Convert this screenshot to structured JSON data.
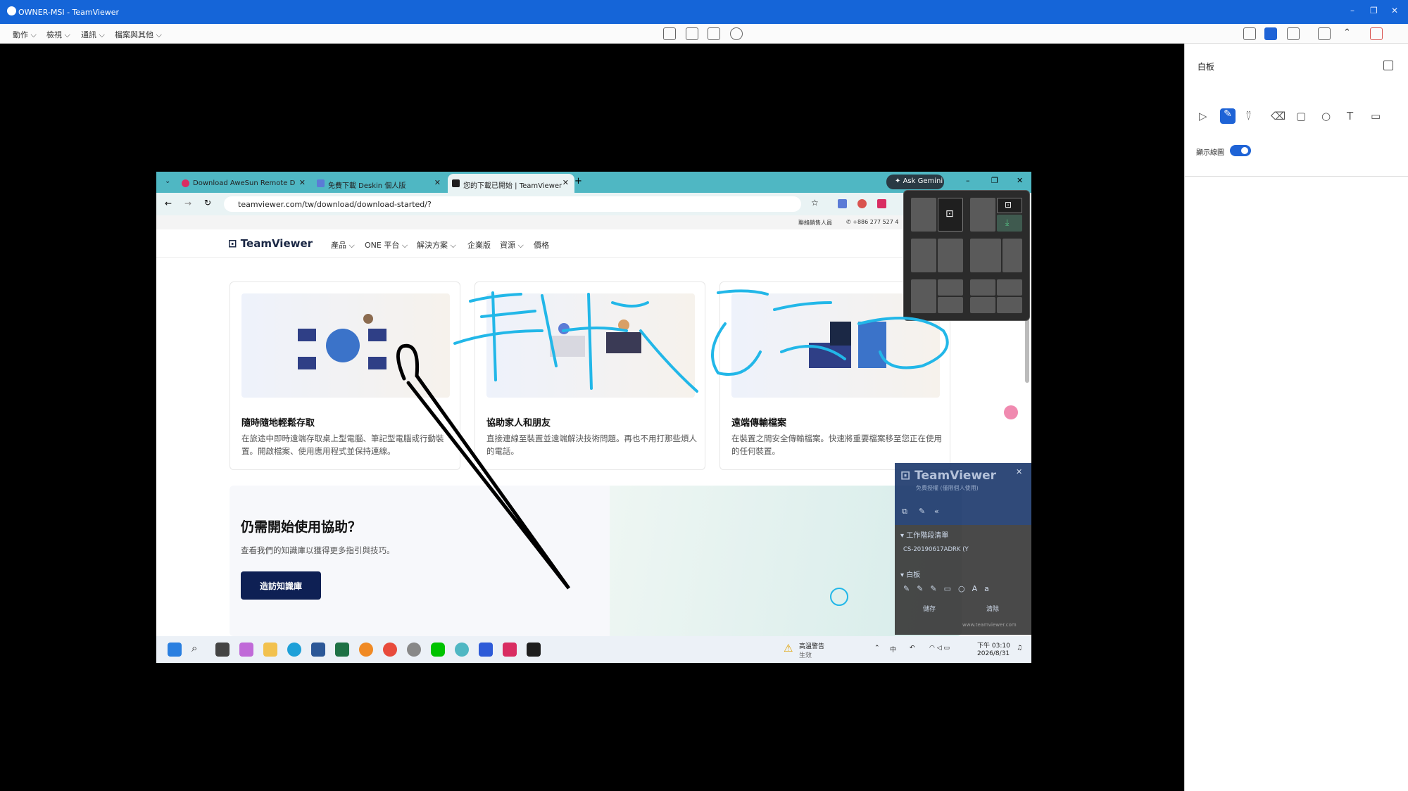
{
  "window": {
    "title": "OWNER-MSI - TeamViewer",
    "controls": [
      "–",
      "❐",
      "✕"
    ]
  },
  "toolbar": {
    "menus": [
      "動作",
      "檢視",
      "通訊",
      "檔案與其他"
    ]
  },
  "whiteboard": {
    "title": "白板",
    "show_strokes_label": "顯示線圖",
    "show_strokes_on": true,
    "tools": [
      "pointer-icon",
      "pen-icon",
      "highlighter-icon",
      "eraser-icon",
      "rectangle-icon",
      "circle-icon",
      "text-icon",
      "note-icon"
    ],
    "active_tool": "pen-icon",
    "accent": "#1e63d6"
  },
  "browser": {
    "tabs": [
      {
        "label": "Download AweSun Remote D",
        "fav": "#d92d62"
      },
      {
        "label": "免費下載 Deskin 個人版",
        "fav": "#5b7bd6"
      },
      {
        "label": "您的下載已開始 | TeamViewer",
        "fav": "#1e1e1e"
      }
    ],
    "ask_gemini": "Ask Gemini",
    "url": "teamviewer.com/tw/download/download-started/?",
    "infobar_left": "聯絡銷售人員",
    "infobar_phone": "+886 277 527 4",
    "brand": "TeamViewer",
    "nav": [
      "產品",
      "ONE 平台",
      "解決方案",
      "企業版",
      "資源",
      "價格"
    ],
    "cards": [
      {
        "title": "隨時隨地輕鬆存取",
        "desc": "在旅途中即時遠端存取桌上型電腦、筆記型電腦或行動裝置。開啟檔案、使用應用程式並保持連線。"
      },
      {
        "title": "協助家人和朋友",
        "desc": "直接連線至裝置並遠端解決技術問題。再也不用打那些煩人的電話。"
      },
      {
        "title": "遠端傳輸檔案",
        "desc": "在裝置之間安全傳輸檔案。快速將重要檔案移至您正在使用的任何裝置。"
      }
    ],
    "help_title": "仍需開始使用協助？",
    "help_desc": "查看我們的知識庫以獲得更多指引與技巧。",
    "help_button": "造訪知識庫"
  },
  "tvpanel": {
    "brand": "TeamViewer",
    "subtitle": "免費授權 (僅限個人使用)",
    "session_list": "工作階段清單",
    "session_item": "CS-20190617ADRK (Y",
    "whiteboard": "白板",
    "save": "儲存",
    "clear": "清除",
    "footer": "www.teamviewer.com"
  },
  "taskbar": {
    "weather_title": "高溫警告",
    "weather_sub": "生效",
    "ime": "中",
    "time": "下午 03:10",
    "date": "2026/8/31"
  },
  "annotation": {
    "color_handwriting": "#22b7e8",
    "color_pointer": "#000000"
  }
}
